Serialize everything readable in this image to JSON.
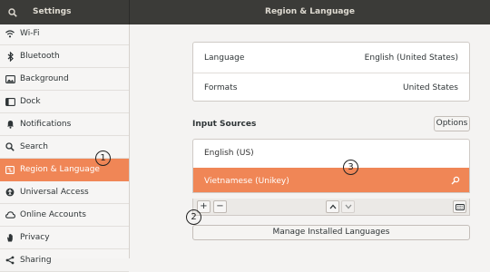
{
  "header": {
    "search_icon": "search-icon",
    "left_title": "Settings",
    "main_title": "Region & Language"
  },
  "sidebar": {
    "items": [
      {
        "label": "Wi-Fi",
        "icon": "wifi-icon"
      },
      {
        "label": "Bluetooth",
        "icon": "bluetooth-icon"
      },
      {
        "label": "Background",
        "icon": "background-icon"
      },
      {
        "label": "Dock",
        "icon": "dock-icon"
      },
      {
        "label": "Notifications",
        "icon": "bell-icon"
      },
      {
        "label": "Search",
        "icon": "search-icon"
      },
      {
        "label": "Region & Language",
        "icon": "flag-icon",
        "active": true
      },
      {
        "label": "Universal Access",
        "icon": "accessibility-icon"
      },
      {
        "label": "Online Accounts",
        "icon": "cloud-icon"
      },
      {
        "label": "Privacy",
        "icon": "hand-icon"
      },
      {
        "label": "Sharing",
        "icon": "share-icon"
      }
    ]
  },
  "main": {
    "language_label": "Language",
    "language_value": "English (United States)",
    "formats_label": "Formats",
    "formats_value": "United States",
    "input_sources_title": "Input Sources",
    "options_label": "Options",
    "sources": [
      {
        "label": "English (US)",
        "selected": false
      },
      {
        "label": "Vietnamese (Unikey)",
        "selected": true
      }
    ],
    "manage_label": "Manage Installed Languages"
  },
  "annotations": [
    "1",
    "2",
    "3"
  ],
  "colors": {
    "accent": "#f08656",
    "headerbar": "#3b3b38"
  }
}
